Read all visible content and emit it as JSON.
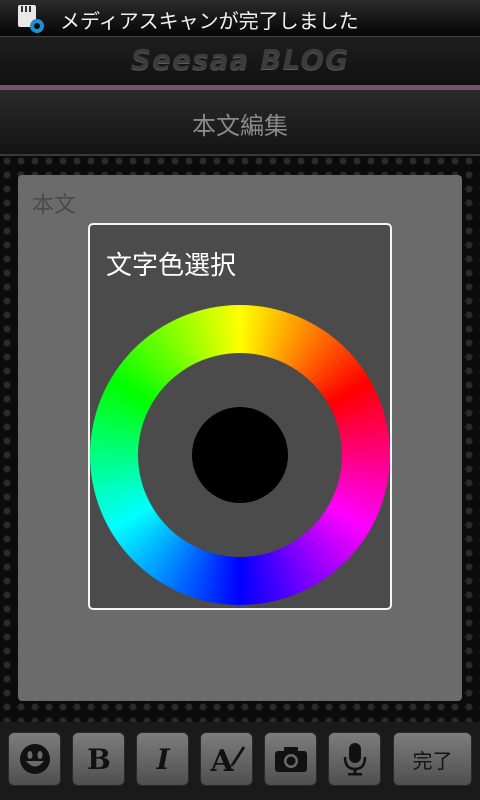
{
  "status_bar": {
    "notification_text": "メディアスキャンが完了しました",
    "icon": "sd-card-settings-icon"
  },
  "header": {
    "logo_text": "Seesaa BLOG",
    "title": "本文編集"
  },
  "editor": {
    "body_label": "本文"
  },
  "dialog": {
    "title": "文字色選択",
    "selected_color": "#000000"
  },
  "toolbar": {
    "buttons": [
      {
        "icon": "emoji-icon"
      },
      {
        "icon": "bold-icon",
        "label": "B"
      },
      {
        "icon": "italic-icon",
        "label": "I"
      },
      {
        "icon": "text-color-icon",
        "label": "A"
      },
      {
        "icon": "camera-icon"
      },
      {
        "icon": "microphone-icon"
      }
    ],
    "done_label": "完了"
  },
  "colors": {
    "accent_line": "#7a4d72",
    "panel": "#6b6b6b",
    "dialog_bg": "#4b4b4b"
  }
}
